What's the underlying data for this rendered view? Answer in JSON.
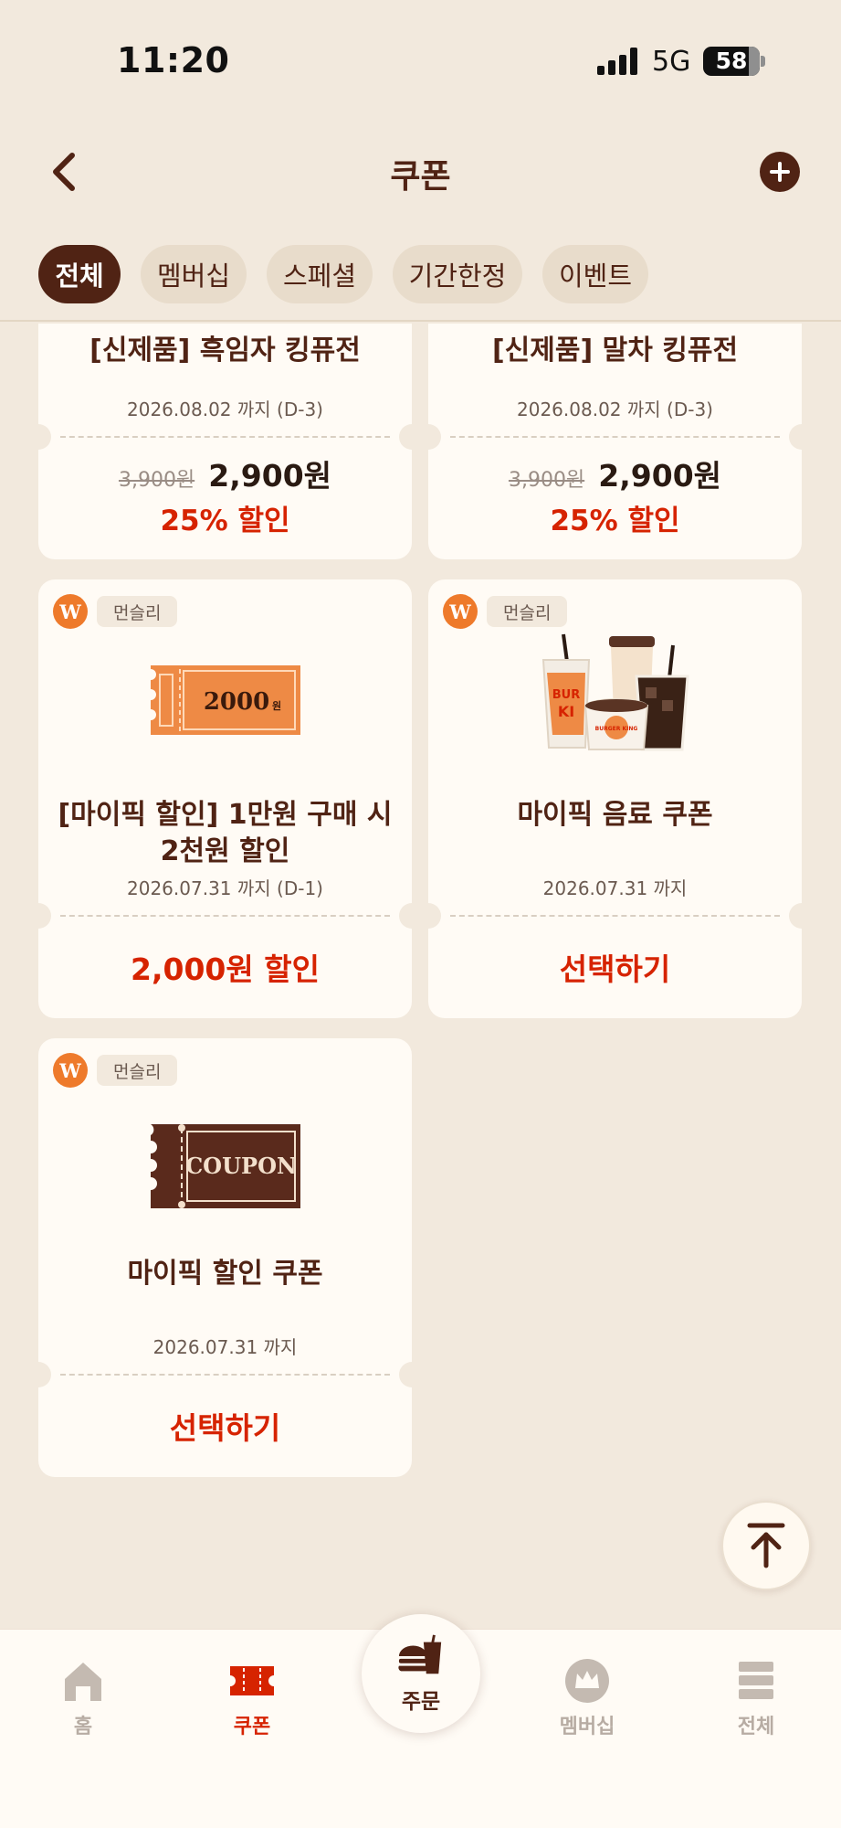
{
  "status_bar": {
    "time": "11:20",
    "network": "5G",
    "battery": "58"
  },
  "header": {
    "title": "쿠폰",
    "back_icon": "chevron-left-icon",
    "add_icon": "plus-circle-icon"
  },
  "tabs": [
    {
      "label": "전체",
      "active": true
    },
    {
      "label": "멤버십",
      "active": false
    },
    {
      "label": "스페셜",
      "active": false
    },
    {
      "label": "기간한정",
      "active": false
    },
    {
      "label": "이벤트",
      "active": false
    }
  ],
  "coupons": [
    {
      "title": "[신제품] 흑임자 킹퓨전",
      "expiry": "2026.08.02 까지  (D-3)",
      "original_price": "3,900원",
      "price": "2,900원",
      "discount": "25% 할인"
    },
    {
      "title": "[신제품] 말차 킹퓨전",
      "expiry": "2026.08.02 까지  (D-3)",
      "original_price": "3,900원",
      "price": "2,900원",
      "discount": "25% 할인"
    },
    {
      "brand": "먼슬리",
      "brand_logo": "W",
      "ticket_text": "2000",
      "ticket_unit": "원",
      "title_line1": "[마이픽 할인] 1만원 구매 시",
      "title_line2": "2천원 할인",
      "expiry": "2026.07.31 까지  (D-1)",
      "action": "2,000원 할인"
    },
    {
      "brand": "먼슬리",
      "brand_logo": "W",
      "cup_text_1": "BUR",
      "cup_text_2": "KI",
      "mug_text": "BURGER KING",
      "title": "마이픽 음료 쿠폰",
      "expiry": "2026.07.31 까지",
      "action": "선택하기"
    },
    {
      "brand": "먼슬리",
      "brand_logo": "W",
      "ticket_text": "COUPON",
      "title": "마이픽 할인 쿠폰",
      "expiry": "2026.07.31 까지",
      "action": "선택하기"
    }
  ],
  "bottom_nav": [
    {
      "label": "홈",
      "icon": "home-icon",
      "active": false
    },
    {
      "label": "쿠폰",
      "icon": "ticket-icon",
      "active": true
    },
    {
      "label": "주문",
      "icon": "burger-drink-icon",
      "active": false
    },
    {
      "label": "멤버십",
      "icon": "crown-icon",
      "active": false
    },
    {
      "label": "전체",
      "icon": "stack-icon",
      "active": false
    }
  ],
  "colors": {
    "brand_brown": "#502314",
    "accent_red": "#D62300",
    "background": "#F2E9DD",
    "card": "#FFFBF5",
    "orange": "#EE7A2B"
  }
}
